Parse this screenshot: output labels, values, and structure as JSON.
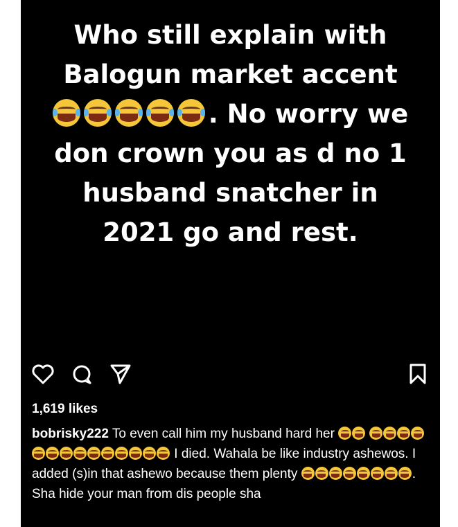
{
  "post": {
    "lines": [
      "Who still explain with",
      "Balogun market accent",
      ". No worry we",
      "don crown you as d no 1",
      "husband snatcher in",
      "2021 go and rest."
    ]
  },
  "actions": {
    "like_icon": "heart-icon",
    "comment_icon": "comment-icon",
    "share_icon": "send-icon",
    "save_icon": "bookmark-icon"
  },
  "likes": "1,619 likes",
  "caption": {
    "username": "bobrisky222",
    "part1": "To even call him my husband hard her",
    "part2": "I died. Wahala be like industry ashewos. I added (s)in that ashewo because them plenty",
    "part3": ". Sha hide your man from dis people sha"
  },
  "emoji": {
    "name": "face-with-tears-of-joy",
    "color": "#f5c63a"
  }
}
